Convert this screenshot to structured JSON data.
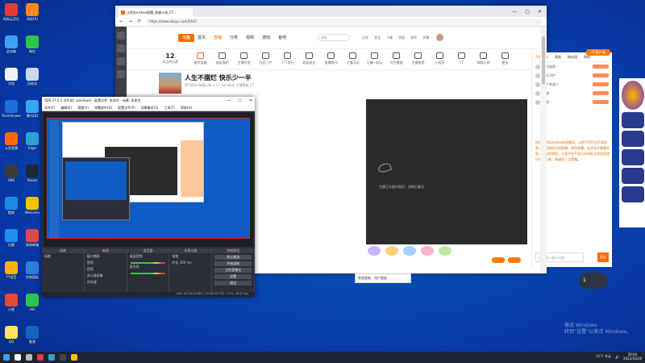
{
  "desktop": {
    "icons": [
      {
        "label": "网易云音乐",
        "color": "#e83a3a"
      },
      {
        "label": "网易UU",
        "color": "#ff8a1a"
      },
      {
        "label": "此电脑",
        "color": "#3da2f5"
      },
      {
        "label": "微信",
        "color": "#2fc54b"
      },
      {
        "label": "文档",
        "color": "#f1f1f1"
      },
      {
        "label": "回收站",
        "color": "#c9d8f0"
      },
      {
        "label": "TeamViewer",
        "color": "#1d6ed9"
      },
      {
        "label": "腾讯QQ",
        "color": "#3aa6f0"
      },
      {
        "label": "斗鱼直播",
        "color": "#ff6a00"
      },
      {
        "label": "Edge",
        "color": "#2ea0d6"
      },
      {
        "label": "OBS",
        "color": "#3b3b3b"
      },
      {
        "label": "Steam",
        "color": "#1b2838"
      },
      {
        "label": "酷狗",
        "color": "#1e88e5"
      },
      {
        "label": "WeGame",
        "color": "#f3c300"
      },
      {
        "label": "迅雷",
        "color": "#1d8ff0"
      },
      {
        "label": "网易邮箱",
        "color": "#e84646"
      },
      {
        "label": "YY语音",
        "color": "#ffb300"
      },
      {
        "label": "控制面板",
        "color": "#2f7ed8"
      },
      {
        "label": "火绒",
        "color": "#e84a3a"
      },
      {
        "label": "360",
        "color": "#2fc54b"
      },
      {
        "label": "QQ",
        "color": "#ffe45c"
      },
      {
        "label": "酷我",
        "color": "#1565c0"
      }
    ]
  },
  "browser": {
    "tab_title": "斗鱼Sonshao直播_穿越火线_CF...",
    "url": "https://www.douyu.com/5443",
    "nav": {
      "back": "←",
      "forward": "→",
      "reload": "⟳"
    },
    "window_controls": [
      "—",
      "▢",
      "✕"
    ]
  },
  "douyu": {
    "logo": "斗鱼",
    "nav_items": [
      "首页",
      "直播",
      "分类",
      "视频",
      "游戏",
      "鱼吧"
    ],
    "active_nav": "直播",
    "search_placeholder": "搜索",
    "tools": [
      "历史",
      "关注",
      "下载",
      "消息",
      "创作",
      "开播"
    ],
    "follow_count": "12",
    "follow_label": "关注的分类",
    "categories": [
      {
        "label": "星秀宝箱",
        "color": "#ff5a5a"
      },
      {
        "label": "抽奖福利",
        "color": "#555"
      },
      {
        "label": "主播学堂",
        "color": "#555"
      },
      {
        "label": "分区门户",
        "color": "#555"
      },
      {
        "label": "人气排行",
        "color": "#555"
      },
      {
        "label": "超级电台",
        "color": "#555"
      },
      {
        "label": "直播周刊",
        "color": "#555"
      },
      {
        "label": "主播活动",
        "color": "#555"
      },
      {
        "label": "主播一起玩",
        "color": "#555"
      },
      {
        "label": "节目播放",
        "color": "#555"
      },
      {
        "label": "主播热榜",
        "color": "#555"
      },
      {
        "label": "小程序",
        "color": "#555"
      },
      {
        "label": "CF",
        "color": "#555"
      },
      {
        "label": "穿越火线",
        "color": "#555"
      },
      {
        "label": "更多",
        "color": "#555"
      }
    ],
    "room": {
      "title": "人生不摆烂 快乐少一半",
      "meta": "ID:5443   穿越火线 > CF   Sonshao   主播等级 27"
    },
    "player_text": "主播正在临时离开，请稍后重试",
    "chat": {
      "tabs": [
        "主播任务",
        "贵族",
        "粉丝团",
        "周榜"
      ],
      "pc_button": "PC客户端",
      "rank": [
        {
          "name": "蓝色星星",
          "badge": ""
        },
        {
          "name": "鱼丸守护",
          "badge": ""
        },
        {
          "name": "一个普通人",
          "badge": ""
        },
        {
          "name": "猫猫",
          "badge": ""
        },
        {
          "name": "鱼吧",
          "badge": ""
        }
      ],
      "system_message": "欢迎来到Sonshao的直播间，斗鱼严厉打击不良信息，斗鱼倡导文明直播，绿色直播。若涉及不健康内容，请及时举报。斗鱼平台不会以任何形式诱导您进行线下交易，请谨防上当受骗。",
      "input_placeholder": "这里输入聊天内容",
      "send": "发送"
    }
  },
  "obs": {
    "title": "OBS 27.0.1 (64-bit, windows) - 配置文件: 未命名 - 场景: 未命名",
    "menu": [
      "文件(F)",
      "编辑(E)",
      "视图(V)",
      "停靠部件(D)",
      "配置文件(P)",
      "场景集合(S)",
      "工具(T)",
      "帮助(H)"
    ],
    "docks": [
      {
        "title": "场景",
        "rows": [
          "场景"
        ]
      },
      {
        "title": "来源",
        "rows": [
          "窗口捕获",
          "音频",
          "音频",
          "显示器采集",
          "浏览器"
        ]
      },
      {
        "title": "混音器",
        "rows": [
          "桌面音频",
          "麦克风"
        ]
      },
      {
        "title": "场景过渡",
        "rows": [
          "渐变",
          "时长 300 ms"
        ]
      },
      {
        "title": "控制按钮",
        "rows": []
      }
    ],
    "buttons": [
      "停止推流",
      "开始录制",
      "工作室模式",
      "设置",
      "退出"
    ],
    "status": "LIVE: 00:00:00   REC: 00:00:00   CPU: 3.1%, 30.00 fps"
  },
  "popup": {
    "left": "状态面板",
    "right": "用户面板"
  },
  "bubble": "1",
  "watermark": {
    "line1": "激活 Windows",
    "line2": "转到“设置”以激活 Windows。"
  },
  "taskbar": {
    "apps": [
      {
        "name": "start",
        "color": "#3aa0ff"
      },
      {
        "name": "search",
        "color": "#ffffff"
      },
      {
        "name": "task-view",
        "color": "#bbbbbb"
      },
      {
        "name": "netease",
        "color": "#e83a3a"
      },
      {
        "name": "edge",
        "color": "#2ea0d6"
      },
      {
        "name": "obs",
        "color": "#444444"
      },
      {
        "name": "file-explorer",
        "color": "#f3c300"
      }
    ],
    "weather": "14°C 多云",
    "time": "20:04",
    "date": "2022/10/26"
  }
}
